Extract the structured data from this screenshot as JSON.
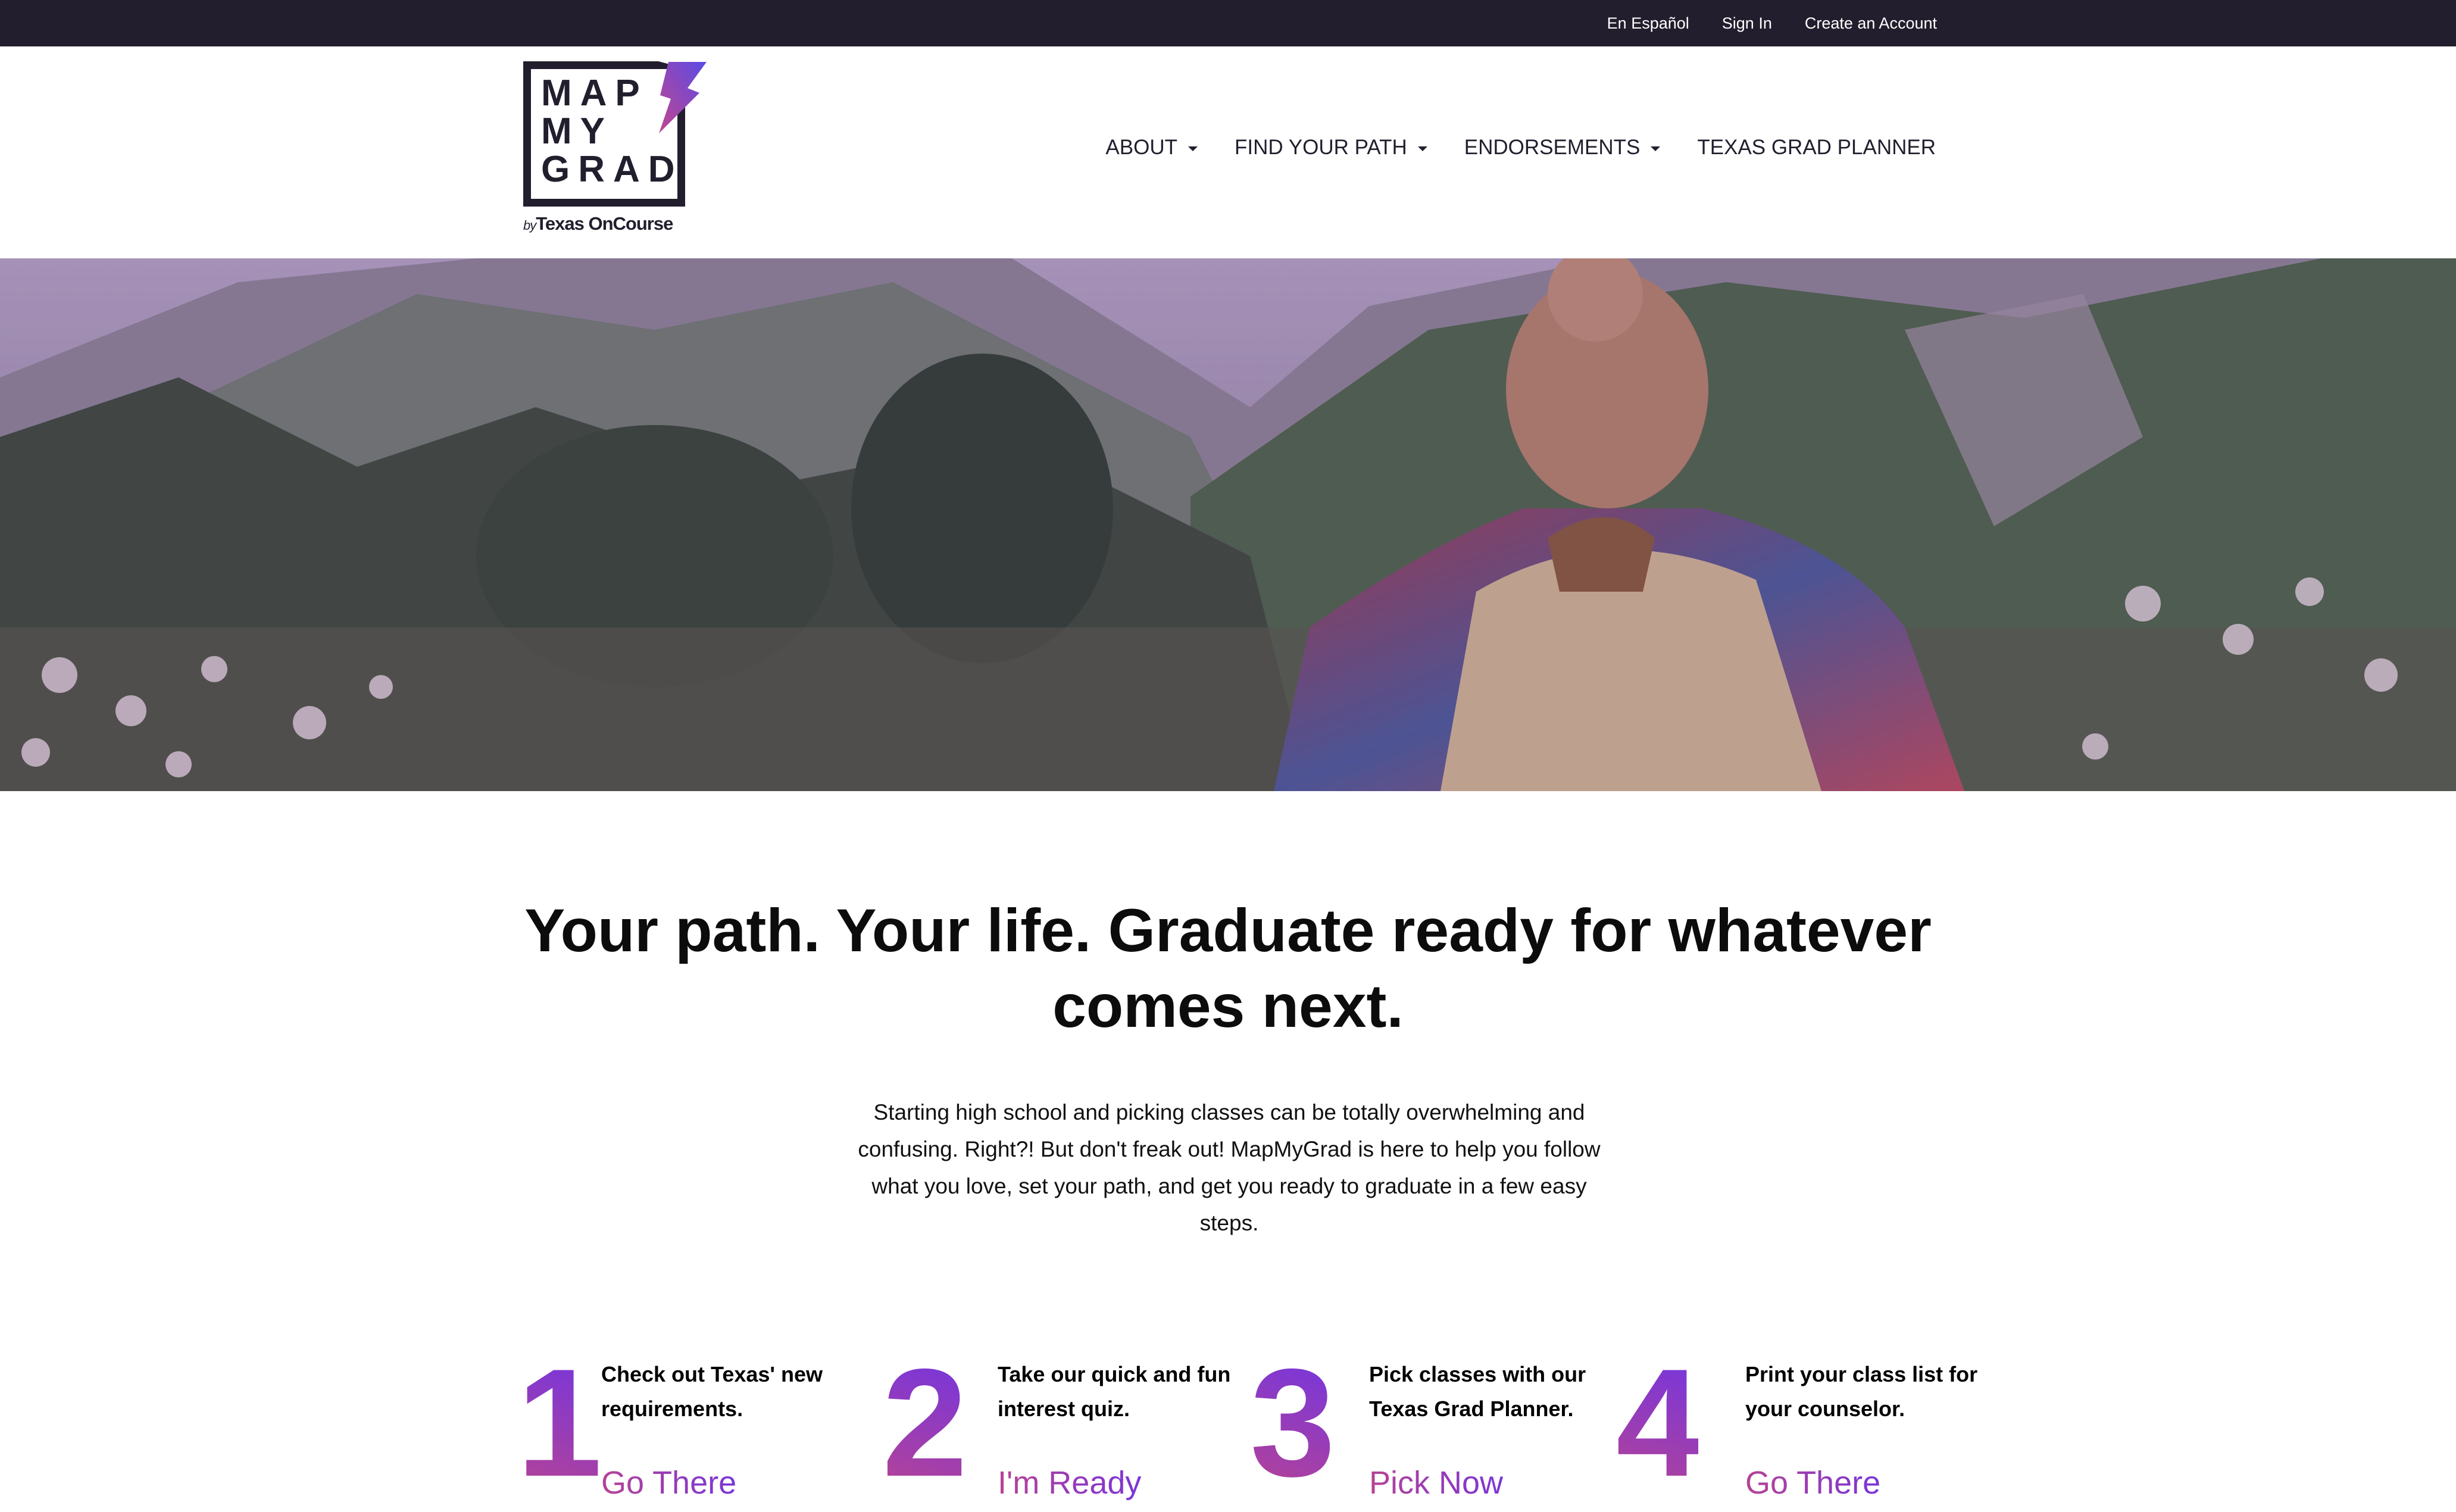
{
  "topbar": {
    "links": [
      "En Español",
      "Sign In",
      "Create an Account"
    ]
  },
  "logo": {
    "line1": "MAP",
    "line2": "MY",
    "line3": "GRAD",
    "by": "by",
    "org": "Texas OnCourse"
  },
  "nav": {
    "items": [
      {
        "label": "ABOUT",
        "dropdown": true
      },
      {
        "label": "FIND YOUR PATH",
        "dropdown": true
      },
      {
        "label": "ENDORSEMENTS",
        "dropdown": true
      },
      {
        "label": "TEXAS GRAD PLANNER",
        "dropdown": false
      }
    ]
  },
  "hero": {
    "image": "hiker-with-backpack-looking-at-mountains"
  },
  "main": {
    "headline_line1": "Your path. Your life. Graduate ready for whatever",
    "headline_line2": "comes next.",
    "intro": "Starting high school and picking classes can be totally overwhelming and confusing. Right?! But don't freak out! MapMyGrad is here to help you follow what you love, set your path, and get you ready to graduate in a few easy steps."
  },
  "steps": [
    {
      "number": "1",
      "text": "Check out Texas' new requirements.",
      "link": "Go There"
    },
    {
      "number": "2",
      "text": "Take our quick and fun interest quiz.",
      "link": "I'm Ready"
    },
    {
      "number": "3",
      "text": "Pick classes with our Texas Grad Planner.",
      "link": "Pick Now"
    },
    {
      "number": "4",
      "text": "Print your class list for your counselor.",
      "link": "Go There"
    }
  ],
  "colors": {
    "topbar": "#221e2d",
    "accent_purple": "#7335e0",
    "accent_pink": "#b64395"
  }
}
